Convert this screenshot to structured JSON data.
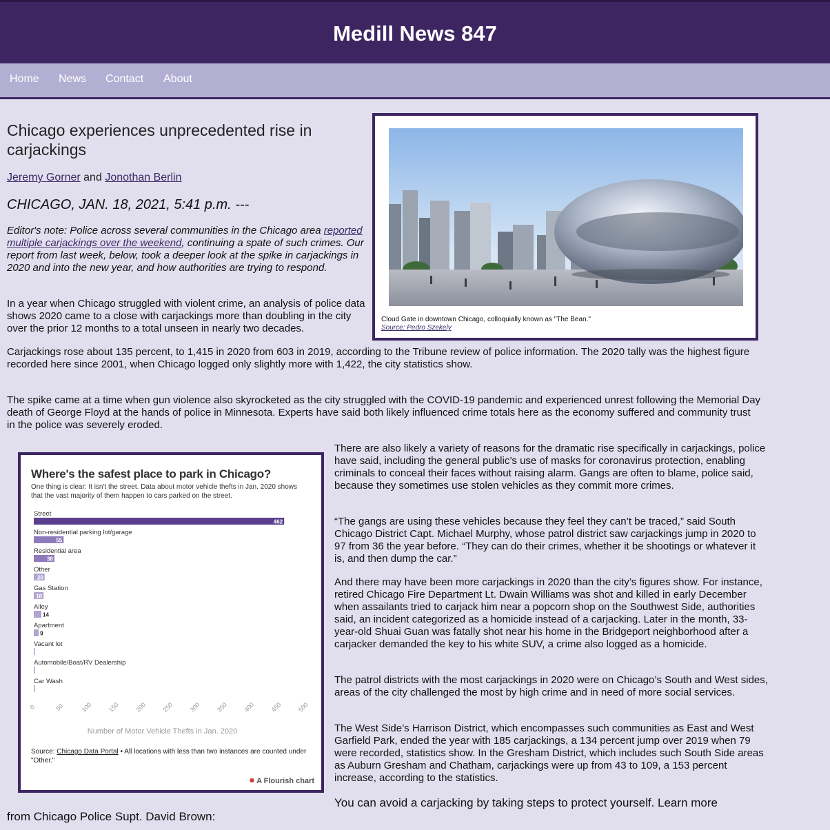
{
  "site": {
    "title": "Medill News 847"
  },
  "nav": [
    "Home",
    "News",
    "Contact",
    "About"
  ],
  "article": {
    "headline": "Chicago experiences unprecedented rise in carjackings",
    "authors": [
      "Jeremy Gorner",
      "Jonothan Berlin"
    ],
    "author_joiner": "and",
    "dateline": "CHICAGO, JAN. 18, 2021, 5:41 p.m. ---",
    "editors_note_prefix": "Editor's note: Police across several communities in the Chicago area ",
    "editors_note_link": "reported multiple carjackings over the weekend",
    "editors_note_suffix": ", continuing a spate of such crimes. Our report from last week, below, took a deeper look at the spike in carjackings in 2020 and into the new year, and how authorities are trying to respond.",
    "paragraphs": [
      "In a year when Chicago struggled with violent crime, an analysis of police data shows 2020 came to a close with carjackings more than doubling in the city over the prior 12 months to a total unseen in nearly two decades.",
      "Carjackings rose about 135 percent, to 1,415 in 2020 from 603 in 2019, according to the Tribune review of police information. The 2020 tally was the highest figure recorded here since 2001, when Chicago logged only slightly more with 1,422, the city statistics show.",
      "The spike came at a time when gun violence also skyrocketed as the city struggled with the COVID-19 pandemic and experienced unrest following the Memorial Day death of George Floyd at the hands of police in Minnesota. Experts have said both likely influenced crime totals here as the economy suffered and community trust in the police was severely eroded.",
      "There are also likely a variety of reasons for the dramatic rise specifically in carjackings, police have said, including the general public’s use of masks for coronavirus protection, enabling criminals to conceal their faces without raising alarm. Gangs are often to blame, police said, because they sometimes use stolen vehicles as they commit more crimes.",
      "“The gangs are using these vehicles because they feel they can’t be traced,” said South Chicago District Capt. Michael Murphy, whose patrol district saw carjackings jump in 2020 to 97 from 36 the year before. “They can do their crimes, whether it be shootings or whatever it is, and then dump the car.”",
      "And there may have been more carjackings in 2020 than the city’s figures show. For instance, retired Chicago Fire Department Lt. Dwain Williams was shot and killed in early December when assailants tried to carjack him near a popcorn shop on the Southwest Side, authorities said, an incident categorized as a homicide instead of a carjacking. Later in the month, 33-year-old Shuai Guan was fatally shot near his home in the Bridgeport neighborhood after a carjacker demanded the key to his white SUV, a crime also logged as a homicide.",
      "The patrol districts with the most carjackings in 2020 were on Chicago’s South and West sides, areas of the city challenged the most by high crime and in need of more social services.",
      "The West Side’s Harrison District, which encompasses such communities as East and West Garfield Park, ended the year with 185 carjackings, a 134 percent jump over 2019 when 79 were recorded, statistics show. In the Gresham District, which includes such South Side areas as Auburn Gresham and Chatham, carjackings were up from 43 to 109, a 153 percent increase, according to the statistics.",
      "You can avoid a carjacking by taking steps to protect yourself. Learn more",
      "from Chicago Police Supt. David Brown:"
    ]
  },
  "photo": {
    "caption": "Cloud Gate in downtown Chicago, colloquially known as \"The Bean.\"",
    "source": "Source: Pedro Szekely"
  },
  "chart_meta": {
    "footer_prefix": "Source: ",
    "footer_link": "Chicago Data Portal",
    "footer_suffix": " • All locations with less than two instances are counted under \"Other.\"",
    "credit": "A Flourish chart",
    "colors": {
      "bar_dark": "#5b3f8f",
      "bar_mid": "#8f7bbb",
      "bar_light": "#b1a4d0"
    }
  },
  "chart_data": {
    "type": "bar",
    "orientation": "horizontal",
    "title": "Where's the safest place to park in Chicago?",
    "subtitle": "One thing is clear: It isn't the street. Data about motor vehicle thefts in Jan. 2020 shows that the vast majority of them happen to cars parked on the street.",
    "categories": [
      "Street",
      "Non-residential parking lot/garage",
      "Residential area",
      "Other",
      "Gas Station",
      "Alley",
      "Apartment",
      "Vacant lot",
      "Automobile/Boat/RV Dealership",
      "Car Wash"
    ],
    "values": [
      462,
      55,
      38,
      20,
      18,
      14,
      9,
      2,
      2,
      2
    ],
    "data_labels": [
      "462",
      "55",
      "38",
      "20",
      "18",
      "14",
      "9",
      "",
      "",
      ""
    ],
    "xlabel": "Number of Motor Vehicle Thefts in Jan. 2020",
    "xlim": [
      0,
      500
    ],
    "xticks": [
      0,
      50,
      100,
      150,
      200,
      250,
      300,
      350,
      400,
      450,
      500
    ]
  }
}
